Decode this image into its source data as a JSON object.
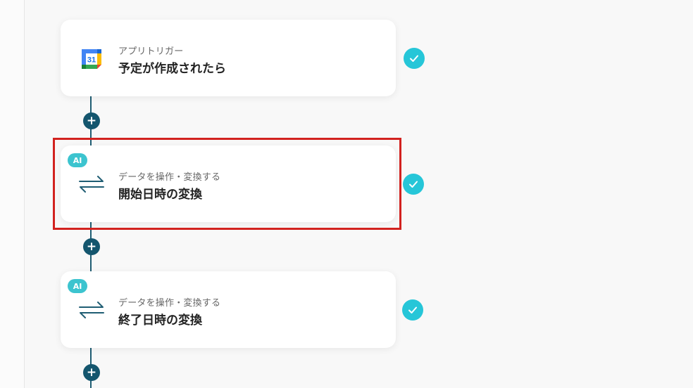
{
  "colors": {
    "accent": "#26c6d8",
    "connector": "#14566e",
    "highlight": "#d2221f",
    "ai_badge": "#3cc4cf"
  },
  "flow": {
    "steps": [
      {
        "icon": "google-calendar-icon",
        "calendar_day": "31",
        "label": "アプリトリガー",
        "title": "予定が作成されたら",
        "status": "completed"
      },
      {
        "icon": "data-transform-arrows-icon",
        "badge": "AI",
        "label": "データを操作・変換する",
        "title": "開始日時の変換",
        "status": "completed",
        "highlighted": true
      },
      {
        "icon": "data-transform-arrows-icon",
        "badge": "AI",
        "label": "データを操作・変換する",
        "title": "終了日時の変換",
        "status": "completed"
      }
    ],
    "add_step_symbol": "+"
  }
}
